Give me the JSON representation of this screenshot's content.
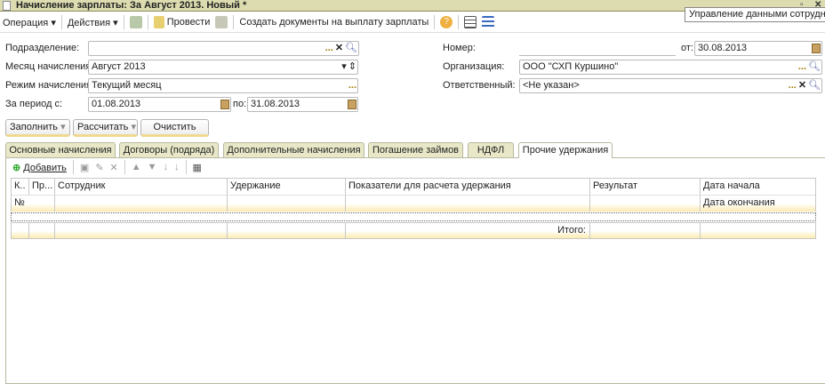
{
  "window": {
    "title": "Начисление зарплаты: За Август 2013. Новый *",
    "tooltip": "Управление данными сотрудника"
  },
  "toolbar": {
    "operation": "Операция",
    "actions": "Действия",
    "post": "Провести",
    "create_docs": "Создать документы на выплату зарплаты"
  },
  "form": {
    "subdivision_label": "Подразделение:",
    "subdivision_value": "",
    "month_label": "Месяц начисления:",
    "month_value": "Август 2013",
    "mode_label": "Режим начисления:",
    "mode_value": "Текущий месяц",
    "period_label": "За период с:",
    "period_from": "01.08.2013",
    "period_to_label": "по:",
    "period_to": "31.08.2013",
    "number_label": "Номер:",
    "number_value": "",
    "date_label": "от:",
    "date_value": "30.08.2013",
    "org_label": "Организация:",
    "org_value": "ООО \"СХП Куршино\"",
    "resp_label": "Ответственный:",
    "resp_value": "<Не указан>"
  },
  "buttons": {
    "fill": "Заполнить",
    "calc": "Рассчитать",
    "clear": "Очистить"
  },
  "tabs": [
    "Основные начисления",
    "Договоры (подряда)",
    "Дополнительные начисления",
    "Погашение займов",
    "НДФЛ",
    "Прочие удержания"
  ],
  "table": {
    "add": "Добавить",
    "headers": [
      "К..",
      "Пр...",
      "Сотрудник",
      "Удержание",
      "Показатели для расчета удержания",
      "Результат",
      "Дата начала"
    ],
    "subheaders": [
      "№",
      "",
      "",
      "",
      "",
      "",
      "Дата окончания"
    ],
    "total_label": "Итого:"
  }
}
